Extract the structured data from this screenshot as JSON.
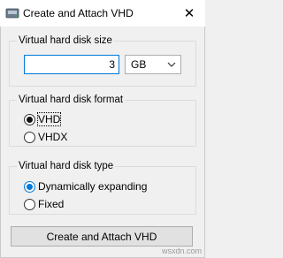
{
  "window": {
    "title": "Create and Attach VHD",
    "close_glyph": "✕",
    "app_icon": "vhd-disk-icon",
    "close_icon": "close-icon"
  },
  "size_group": {
    "legend": "Virtual hard disk size",
    "size_value": "3",
    "unit_selected": "GB",
    "dropdown_icon": "chevron-down-icon"
  },
  "format_group": {
    "legend": "Virtual hard disk format",
    "options": [
      {
        "label": "VHD",
        "selected": true
      },
      {
        "label": "VHDX",
        "selected": false
      }
    ]
  },
  "type_group": {
    "legend": "Virtual hard disk type",
    "options": [
      {
        "label": "Dynamically expanding",
        "selected": true
      },
      {
        "label": "Fixed",
        "selected": false
      }
    ]
  },
  "actions": {
    "create_label": "Create and Attach VHD"
  },
  "watermark": "wsxdn.com",
  "colors": {
    "accent": "#0078d7",
    "background": "#f0f0f0",
    "titlebar": "#ffffff"
  }
}
